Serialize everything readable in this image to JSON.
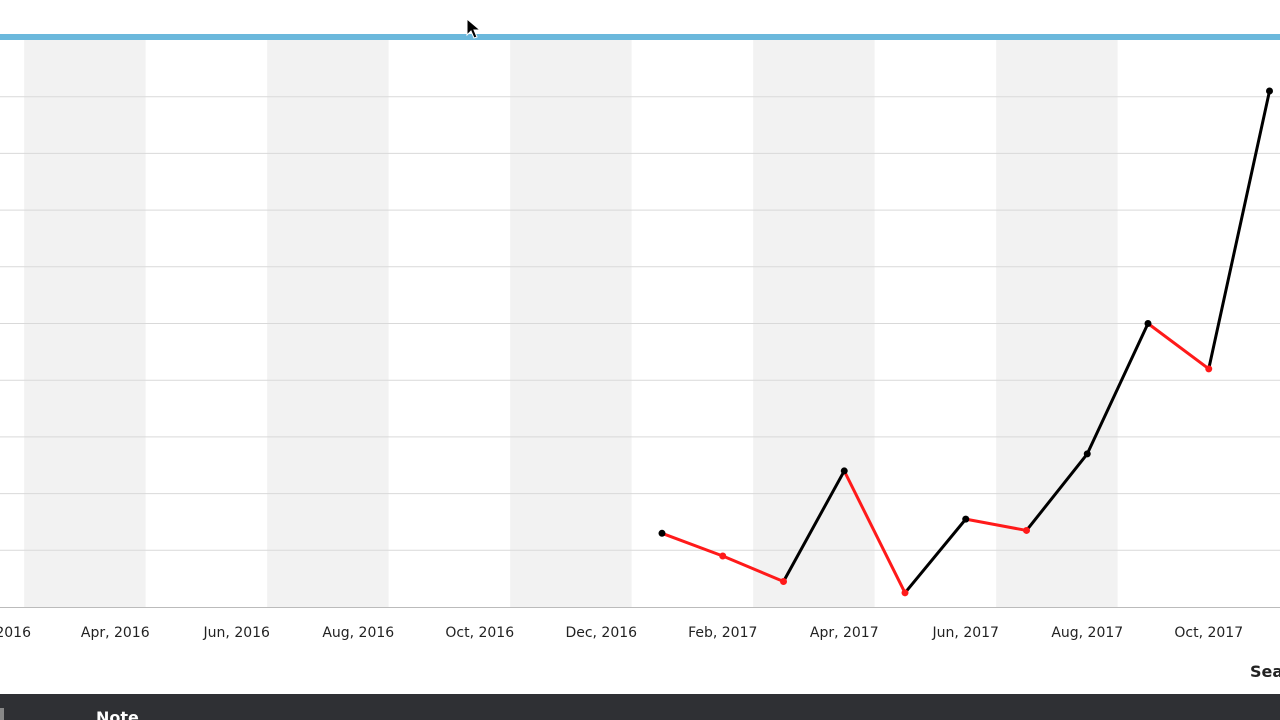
{
  "chart_data": {
    "type": "line",
    "x_tick_labels": [
      "2016",
      "Apr, 2016",
      "Jun, 2016",
      "Aug, 2016",
      "Oct, 2016",
      "Dec, 2016",
      "Feb, 2017",
      "Apr, 2017",
      "Jun, 2017",
      "Aug, 2017",
      "Oct, 2017"
    ],
    "x_axis_title": "Sea",
    "grid": true,
    "series": [
      {
        "points": [
          {
            "x": "2017-01-01",
            "y": 1.3
          },
          {
            "x": "2017-02-01",
            "y": 0.9
          },
          {
            "x": "2017-03-01",
            "y": 0.45
          },
          {
            "x": "2017-04-01",
            "y": 2.4
          },
          {
            "x": "2017-05-01",
            "y": 0.25
          },
          {
            "x": "2017-06-01",
            "y": 1.55
          },
          {
            "x": "2017-07-01",
            "y": 1.35
          },
          {
            "x": "2017-08-01",
            "y": 2.7
          },
          {
            "x": "2017-09-01",
            "y": 5.0
          },
          {
            "x": "2017-10-01",
            "y": 4.2
          },
          {
            "x": "2017-11-01",
            "y": 9.1
          }
        ]
      }
    ],
    "segment_colors": {
      "up": "#000000",
      "down": "#ff1a1a"
    },
    "alternate_band_color": "#f2f2f2",
    "gridline_color": "#d9d9d9",
    "ylim": [
      0,
      10
    ]
  },
  "header_line_color": "#6bb8dc",
  "footer": {
    "note_label": "Note"
  }
}
